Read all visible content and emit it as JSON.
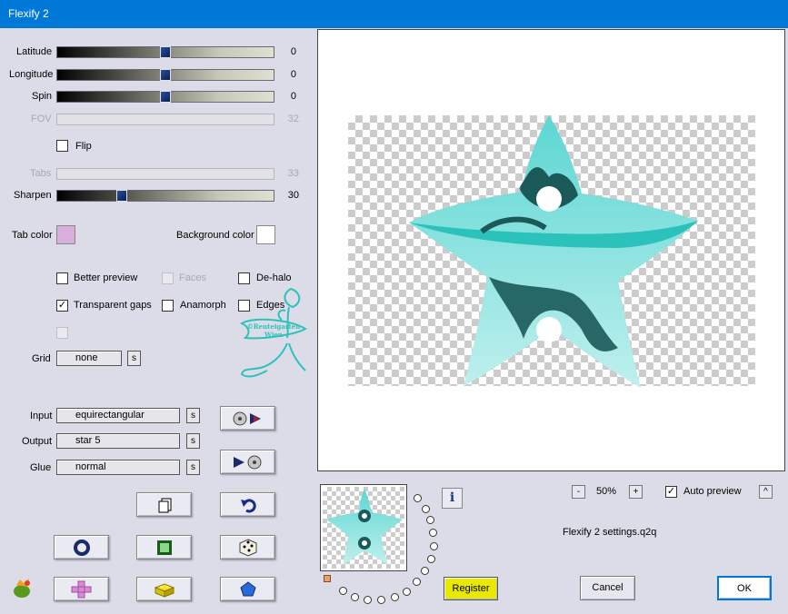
{
  "window": {
    "title": "Flexify 2"
  },
  "sliders": {
    "latitude": {
      "label": "Latitude",
      "value": "0",
      "pos": 0.5
    },
    "longitude": {
      "label": "Longitude",
      "value": "0",
      "pos": 0.5
    },
    "spin": {
      "label": "Spin",
      "value": "0",
      "pos": 0.5
    },
    "fov": {
      "label": "FOV",
      "value": "32"
    },
    "tabs": {
      "label": "Tabs",
      "value": "33"
    },
    "sharpen": {
      "label": "Sharpen",
      "value": "30",
      "pos": 0.3
    }
  },
  "checks": {
    "flip": {
      "label": "Flip",
      "checked": false
    },
    "better_preview": {
      "label": "Better preview",
      "checked": false
    },
    "faces": {
      "label": "Faces",
      "checked": false
    },
    "dehalo": {
      "label": "De-halo",
      "checked": false
    },
    "transparent_gaps": {
      "label": "Transparent gaps",
      "checked": true,
      "mark": "✓"
    },
    "anamorph": {
      "label": "Anamorph",
      "checked": false
    },
    "edges": {
      "label": "Edges",
      "checked": false
    },
    "auto_preview": {
      "label": "Auto preview",
      "checked": true,
      "mark": "✓"
    }
  },
  "colors": {
    "tab_color_label": "Tab color",
    "tab_color": "#d8aedc",
    "background_color_label": "Background color",
    "background_color": "#ffffff"
  },
  "grid": {
    "label": "Grid",
    "value": "none",
    "s": "s"
  },
  "mapping": {
    "input_label": "Input",
    "input_value": "equirectangular",
    "output_label": "Output",
    "output_value": "star 5",
    "glue_label": "Glue",
    "glue_value": "normal",
    "s": "s"
  },
  "watermark": {
    "line1": "©Renteigarten",
    "line2": "Wien"
  },
  "zoom": {
    "minus": "-",
    "value": "50%",
    "plus": "+",
    "expand": "^"
  },
  "settings_file": "Flexify 2 settings.q2q",
  "buttons": {
    "register": "Register",
    "cancel": "Cancel",
    "ok": "OK",
    "info": "i"
  },
  "accent": {
    "teal_light": "#9ee8e6",
    "teal": "#2cc2bc",
    "teal_dark": "#1a5a58",
    "register_bg": "#e8e800"
  }
}
